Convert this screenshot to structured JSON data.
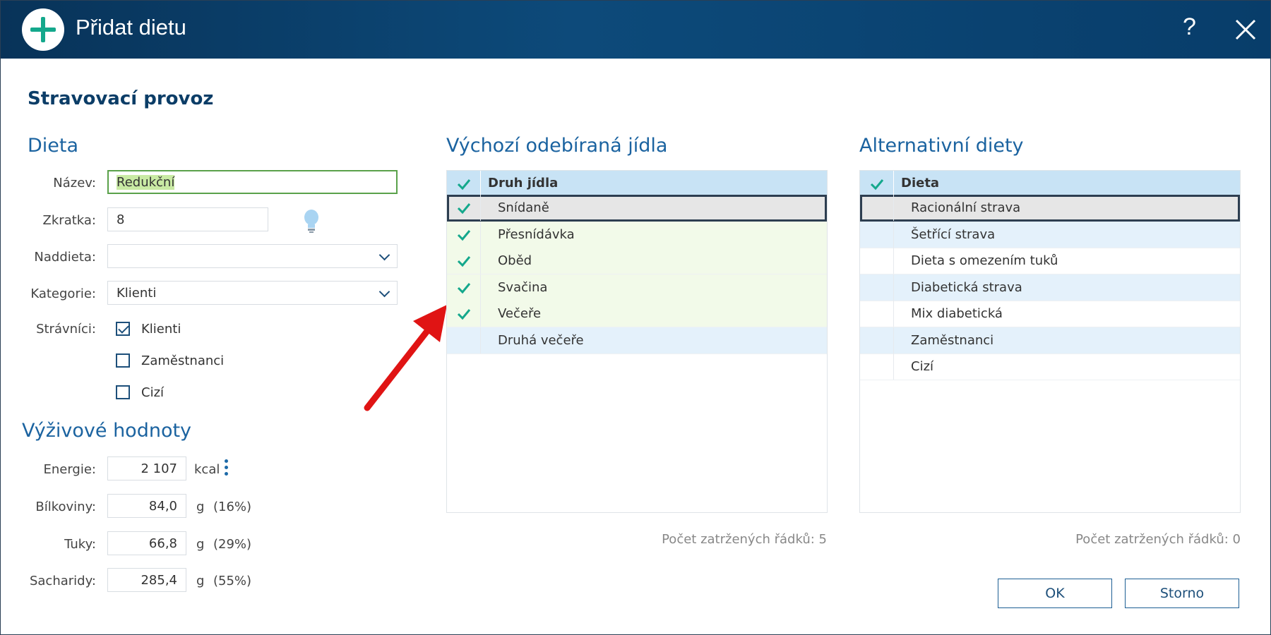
{
  "window": {
    "title": "Přidat dietu",
    "help": "?"
  },
  "section_title": "Stravovací provoz",
  "dieta": {
    "heading": "Dieta",
    "nazev_label": "Název:",
    "nazev_value": "Redukční",
    "zkratka_label": "Zkratka:",
    "zkratka_value": "8",
    "naddieta_label": "Naddieta:",
    "naddieta_value": "",
    "kategorie_label": "Kategorie:",
    "kategorie_value": "Klienti",
    "stravnici_label": "Strávníci:",
    "stravnici": [
      {
        "label": "Klienti",
        "checked": true
      },
      {
        "label": "Zaměstnanci",
        "checked": false
      },
      {
        "label": "Cizí",
        "checked": false
      }
    ]
  },
  "vyzivove": {
    "heading": "Výživové hodnoty",
    "rows": [
      {
        "label": "Energie:",
        "value": "2 107",
        "unit": "kcal",
        "pct": ""
      },
      {
        "label": "Bílkoviny:",
        "value": "84,0",
        "unit": "g",
        "pct": "(16%)"
      },
      {
        "label": "Tuky:",
        "value": "66,8",
        "unit": "g",
        "pct": "(29%)"
      },
      {
        "label": "Sacharidy:",
        "value": "285,4",
        "unit": "g",
        "pct": "(55%)"
      }
    ]
  },
  "jidla": {
    "heading": "Výchozí odebíraná jídla",
    "column": "Druh jídla",
    "rows": [
      {
        "label": "Snídaně",
        "checked": true
      },
      {
        "label": "Přesnídávka",
        "checked": true
      },
      {
        "label": "Oběd",
        "checked": true
      },
      {
        "label": "Svačina",
        "checked": true
      },
      {
        "label": "Večeře",
        "checked": true
      },
      {
        "label": "Druhá večeře",
        "checked": false
      }
    ],
    "count": "Počet zatržených řádků: 5"
  },
  "alternativni": {
    "heading": "Alternativní diety",
    "column": "Dieta",
    "rows": [
      {
        "label": "Racionální strava",
        "checked": false
      },
      {
        "label": "Šetřící strava",
        "checked": false
      },
      {
        "label": "Dieta s omezením tuků",
        "checked": false
      },
      {
        "label": "Diabetická strava",
        "checked": false
      },
      {
        "label": "Mix diabetická",
        "checked": false
      },
      {
        "label": "Zaměstnanci",
        "checked": false
      },
      {
        "label": "Cizí",
        "checked": false
      }
    ],
    "count": "Počet zatržených řádků: 0"
  },
  "buttons": {
    "ok": "OK",
    "storno": "Storno"
  },
  "colors": {
    "titlebar": "#0b3f6b",
    "accent": "#1b63a0",
    "check": "#14a88c",
    "arrow": "#e01414"
  }
}
